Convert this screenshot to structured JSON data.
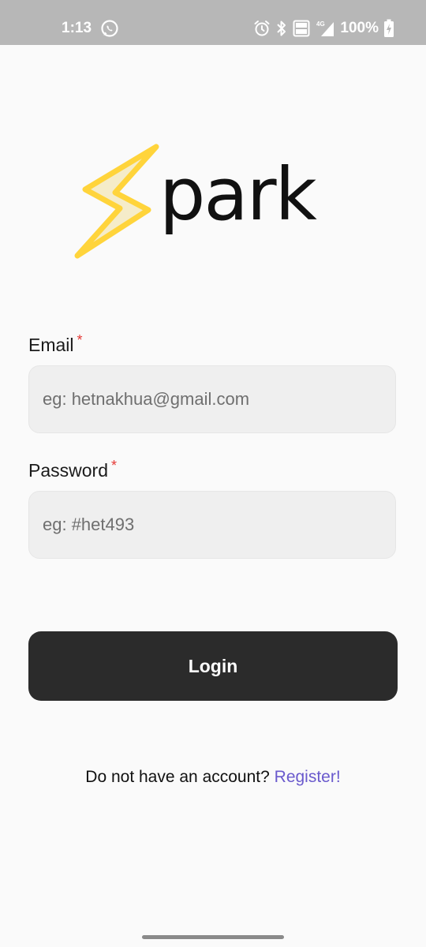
{
  "status_bar": {
    "time": "1:13",
    "battery_percent": "100%",
    "network_label": "4G",
    "icons": [
      "whatsapp-icon",
      "alarm-icon",
      "bluetooth-icon",
      "volte-icon",
      "signal-icon",
      "battery-charging-icon"
    ]
  },
  "logo": {
    "text": "park",
    "bolt_color": "#ffd43b",
    "bolt_fill": "#f5ecc9"
  },
  "form": {
    "email": {
      "label": "Email",
      "required_mark": "*",
      "placeholder": "eg: hetnakhua@gmail.com"
    },
    "password": {
      "label": "Password",
      "required_mark": "*",
      "placeholder": "eg: #het493"
    },
    "login_label": "Login"
  },
  "footer": {
    "prompt": "Do not have an account?",
    "register_label": "Register!"
  },
  "colors": {
    "button": "#2b2b2b",
    "link": "#6a5acd",
    "required": "#e53935"
  }
}
